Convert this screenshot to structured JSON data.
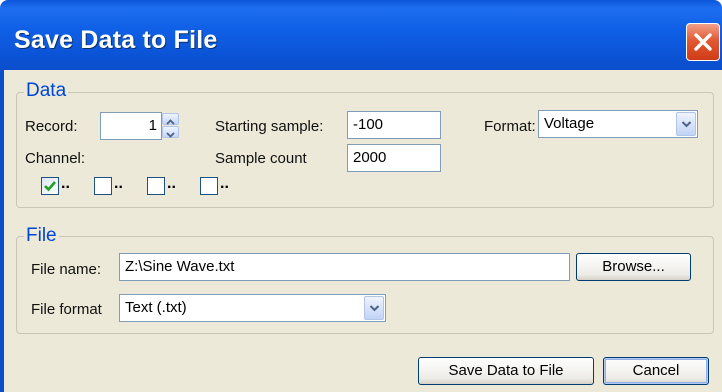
{
  "window": {
    "title": "Save Data to File"
  },
  "data_group": {
    "legend": "Data",
    "record_label": "Record:",
    "record_value": "1",
    "starting_sample_label": "Starting sample:",
    "starting_sample_value": "-100",
    "format_label": "Format:",
    "format_value": "Voltage",
    "channel_label": "Channel:",
    "sample_count_label": "Sample count",
    "sample_count_value": "2000",
    "channels": [
      {
        "dots": "..",
        "checked": true
      },
      {
        "dots": "..",
        "checked": false
      },
      {
        "dots": "..",
        "checked": false
      },
      {
        "dots": "..",
        "checked": false
      }
    ]
  },
  "file_group": {
    "legend": "File",
    "file_name_label": "File name:",
    "file_name_value": "Z:\\Sine Wave.txt",
    "browse_label": "Browse...",
    "file_format_label": "File format",
    "file_format_value": "Text (.txt)"
  },
  "buttons": {
    "save_label": "Save Data to File",
    "cancel_label": "Cancel"
  },
  "colors": {
    "title_bar": "#0a56d8",
    "dialog_bg": "#ece9d8",
    "legend": "#0046d5",
    "close_button": "#e25a32"
  }
}
